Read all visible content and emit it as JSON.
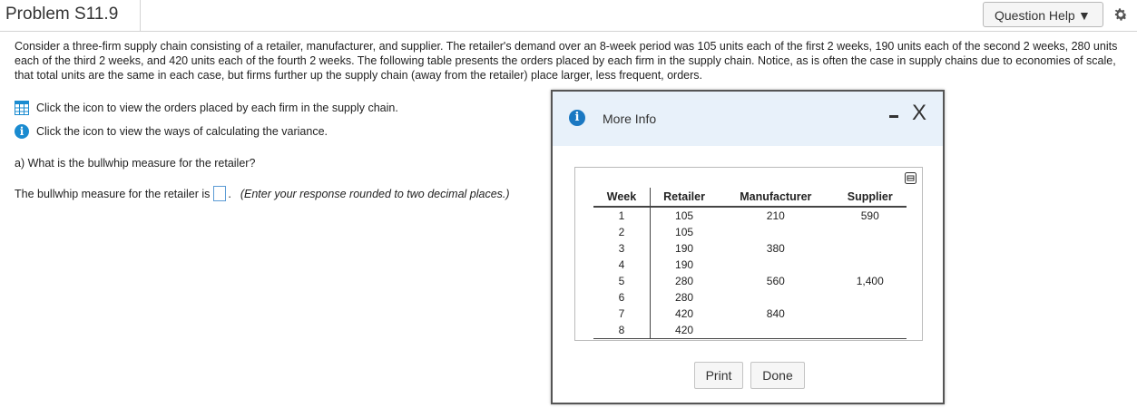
{
  "header": {
    "title": "Problem S11.9",
    "help_label": "Question Help",
    "help_caret": "▼"
  },
  "problem": {
    "intro": "Consider a three-firm supply chain consisting of a retailer, manufacturer, and supplier. The retailer's demand over an 8-week period was 105 units each of the first 2 weeks, 190 units each of the second 2 weeks, 280 units each of the third 2 weeks, and 420 units each of the fourth 2 weeks. The following table presents the orders placed by each firm in the supply chain. Notice, as is often the case in supply chains due to economies of scale, that total units are the same in each case, but firms further up the supply chain (away from the retailer) place larger, less frequent, orders.",
    "link_table": "Click the icon to view the orders placed by each firm in the supply chain.",
    "link_variance": "Click the icon to view the ways of calculating the variance.",
    "question_a": "a) What is the bullwhip measure for the retailer?",
    "answer_prefix": "The bullwhip measure for the retailer is",
    "answer_value": "",
    "answer_suffix": ".",
    "answer_hint": "(Enter your response rounded to two decimal places.)"
  },
  "modal": {
    "title": "More Info",
    "info_glyph": "i",
    "close_glyph": "X",
    "columns": [
      "Week",
      "Retailer",
      "Manufacturer",
      "Supplier"
    ],
    "rows": [
      [
        "1",
        "105",
        "210",
        "590"
      ],
      [
        "2",
        "105",
        "",
        ""
      ],
      [
        "3",
        "190",
        "380",
        ""
      ],
      [
        "4",
        "190",
        "",
        ""
      ],
      [
        "5",
        "280",
        "560",
        "1,400"
      ],
      [
        "6",
        "280",
        "",
        ""
      ],
      [
        "7",
        "420",
        "840",
        ""
      ],
      [
        "8",
        "420",
        "",
        ""
      ]
    ],
    "print_label": "Print",
    "done_label": "Done"
  },
  "icons": {
    "info_glyph": "i",
    "gear": "gear-icon",
    "grid": "table-grid-icon",
    "copy": "copy-icon"
  },
  "colors": {
    "info_blue": "#1a8bd0",
    "modal_header": "#e8f1fa",
    "answer_box_border": "#5b9bd5"
  }
}
